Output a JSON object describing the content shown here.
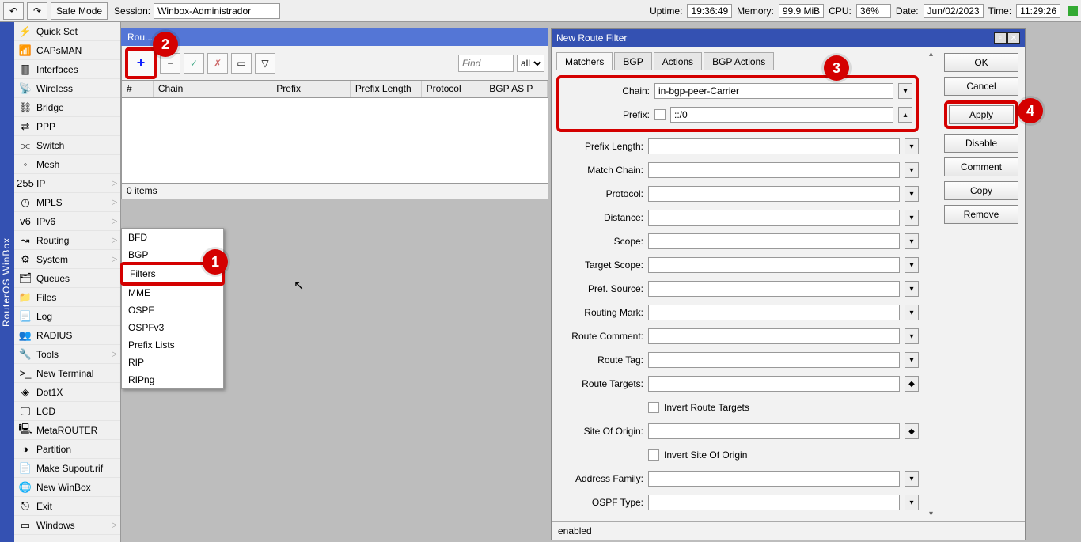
{
  "topbar": {
    "back_icon": "↶",
    "fwd_icon": "↷",
    "safe_mode": "Safe Mode",
    "session_label": "Session:",
    "session_value": "Winbox-Administrador",
    "status": {
      "uptime_l": "Uptime:",
      "uptime_v": "19:36:49",
      "memory_l": "Memory:",
      "memory_v": "99.9 MiB",
      "cpu_l": "CPU:",
      "cpu_v": "36%",
      "date_l": "Date:",
      "date_v": "Jun/02/2023",
      "time_l": "Time:",
      "time_v": "11:29:26"
    }
  },
  "app_title": "RouterOS WinBox",
  "sidebar": [
    {
      "icon": "⚡",
      "label": "Quick Set"
    },
    {
      "icon": "📶",
      "label": "CAPsMAN"
    },
    {
      "icon": "🀫",
      "label": "Interfaces"
    },
    {
      "icon": "📡",
      "label": "Wireless"
    },
    {
      "icon": "⛓",
      "label": "Bridge"
    },
    {
      "icon": "⇄",
      "label": "PPP"
    },
    {
      "icon": "⫘",
      "label": "Switch"
    },
    {
      "icon": "◦",
      "label": "Mesh"
    },
    {
      "icon": "255",
      "label": "IP",
      "arrow": true
    },
    {
      "icon": "◴",
      "label": "MPLS",
      "arrow": true
    },
    {
      "icon": "v6",
      "label": "IPv6",
      "arrow": true
    },
    {
      "icon": "↝",
      "label": "Routing",
      "arrow": true
    },
    {
      "icon": "⚙",
      "label": "System",
      "arrow": true
    },
    {
      "icon": "🗂",
      "label": "Queues"
    },
    {
      "icon": "📁",
      "label": "Files"
    },
    {
      "icon": "📃",
      "label": "Log"
    },
    {
      "icon": "👥",
      "label": "RADIUS"
    },
    {
      "icon": "🔧",
      "label": "Tools",
      "arrow": true
    },
    {
      "icon": ">_",
      "label": "New Terminal"
    },
    {
      "icon": "◈",
      "label": "Dot1X"
    },
    {
      "icon": "🖵",
      "label": "LCD"
    },
    {
      "icon": "🖳",
      "label": "MetaROUTER"
    },
    {
      "icon": "◑",
      "label": "Partition"
    },
    {
      "icon": "📄",
      "label": "Make Supout.rif"
    },
    {
      "icon": "🌐",
      "label": "New WinBox"
    },
    {
      "icon": "⎋",
      "label": "Exit"
    },
    {
      "icon": "▭",
      "label": "Windows",
      "arrow": true
    }
  ],
  "rf": {
    "title": "Rou...",
    "toolbar_icons": {
      "add": "+",
      "remove": "−",
      "enable": "✓",
      "disable": "✗",
      "comment": "▭",
      "funnel": "▽"
    },
    "find_ph": "Find",
    "all": "all",
    "cols": [
      "#",
      "Chain",
      "Prefix",
      "Prefix Length",
      "Protocol",
      "BGP AS P"
    ],
    "status": "0 items"
  },
  "submenu": [
    "BFD",
    "BGP",
    "Filters",
    "MME",
    "OSPF",
    "OSPFv3",
    "Prefix Lists",
    "RIP",
    "RIPng"
  ],
  "dialog": {
    "title": "New Route Filter",
    "tabs": [
      "Matchers",
      "BGP",
      "Actions",
      "BGP Actions"
    ],
    "rows": [
      {
        "label": "Chain:",
        "value": "in-bgp-peer-Carrier",
        "dd": true
      },
      {
        "label": "Prefix:",
        "value": "::/0",
        "checkbox": true,
        "dd": "▴"
      },
      {
        "label": "Prefix Length:",
        "dd": true
      },
      {
        "label": "Match Chain:",
        "dd": true
      },
      {
        "label": "Protocol:",
        "dd": true
      },
      {
        "label": "Distance:",
        "dd": true
      },
      {
        "label": "Scope:",
        "dd": true
      },
      {
        "label": "Target Scope:",
        "dd": true
      },
      {
        "label": "Pref. Source:",
        "dd": true
      },
      {
        "label": "Routing Mark:",
        "dd": true
      },
      {
        "label": "Route Comment:",
        "dd": true
      },
      {
        "label": "Route Tag:",
        "dd": true
      },
      {
        "label": "Route Targets:",
        "dd": "◆"
      },
      {
        "indent": true,
        "check_label": "Invert Route Targets"
      },
      {
        "label": "Site Of Origin:",
        "dd": "◆"
      },
      {
        "indent": true,
        "check_label": "Invert Site Of Origin"
      },
      {
        "label": "Address Family:",
        "dd": true
      },
      {
        "label": "OSPF Type:",
        "dd": true
      }
    ],
    "actions": [
      "OK",
      "Cancel",
      "Apply",
      "Disable",
      "Comment",
      "Copy",
      "Remove"
    ],
    "status": "enabled"
  },
  "badges": {
    "1": "1",
    "2": "2",
    "3": "3",
    "4": "4"
  }
}
